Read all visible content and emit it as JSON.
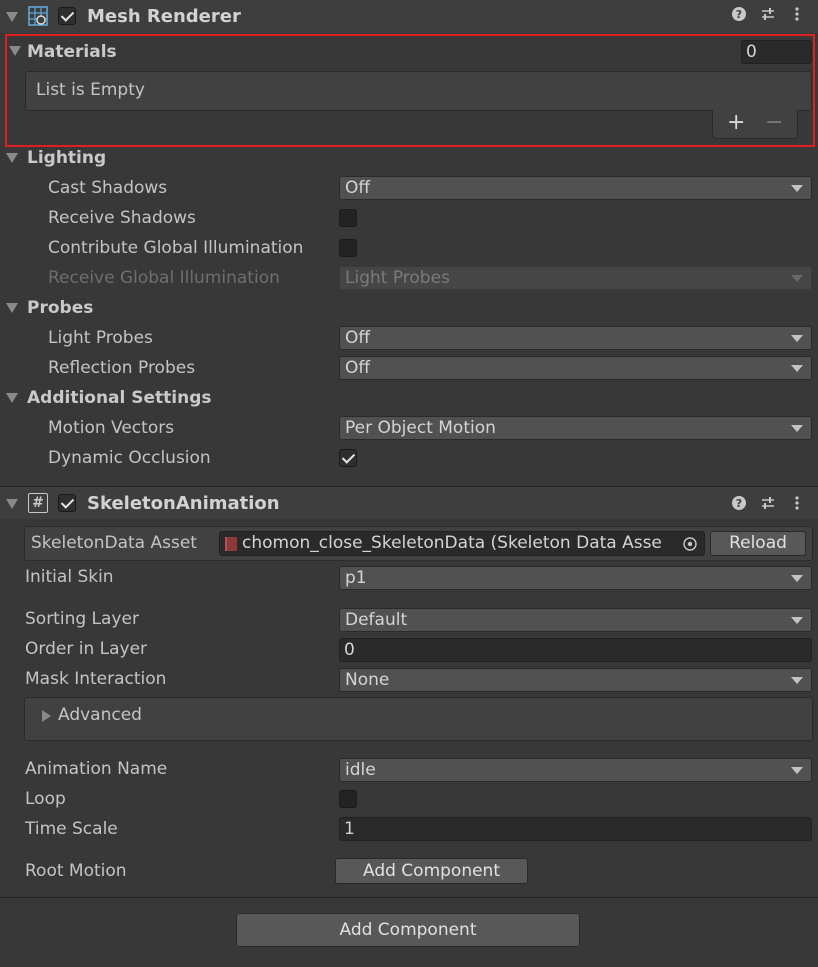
{
  "mesh_renderer": {
    "title": "Mesh Renderer",
    "materials": {
      "label": "Materials",
      "count": "0",
      "empty_text": "List is Empty",
      "add_label": "+",
      "remove_label": "−"
    },
    "lighting": {
      "label": "Lighting",
      "cast_shadows_label": "Cast Shadows",
      "cast_shadows_value": "Off",
      "receive_shadows_label": "Receive Shadows",
      "contribute_gi_label": "Contribute Global Illumination",
      "receive_gi_label": "Receive Global Illumination",
      "receive_gi_value": "Light Probes"
    },
    "probes": {
      "label": "Probes",
      "light_probes_label": "Light Probes",
      "light_probes_value": "Off",
      "reflection_probes_label": "Reflection Probes",
      "reflection_probes_value": "Off"
    },
    "additional": {
      "label": "Additional Settings",
      "motion_vectors_label": "Motion Vectors",
      "motion_vectors_value": "Per Object Motion",
      "dynamic_occlusion_label": "Dynamic Occlusion"
    }
  },
  "skeleton_animation": {
    "title": "SkeletonAnimation",
    "script_icon": "#",
    "skeleton_data_label": "SkeletonData Asset",
    "skeleton_data_value": "chomon_close_SkeletonData (Skeleton Data Asse",
    "reload_label": "Reload",
    "initial_skin_label": "Initial Skin",
    "initial_skin_value": "p1",
    "sorting_layer_label": "Sorting Layer",
    "sorting_layer_value": "Default",
    "order_in_layer_label": "Order in Layer",
    "order_in_layer_value": "0",
    "mask_interaction_label": "Mask Interaction",
    "mask_interaction_value": "None",
    "advanced_label": "Advanced",
    "animation_name_label": "Animation Name",
    "animation_name_value": "idle",
    "loop_label": "Loop",
    "time_scale_label": "Time Scale",
    "time_scale_value": "1",
    "root_motion_label": "Root Motion",
    "root_motion_button": "Add Component"
  },
  "footer": {
    "add_component_label": "Add Component"
  },
  "icons": {
    "help": "help-icon",
    "presets": "presets-icon",
    "menu": "kebab-menu-icon"
  },
  "colors": {
    "panel_bg": "#383838",
    "header_bg": "#3e3e3e",
    "highlight_border": "#e01f1f",
    "field_bg": "#515151"
  }
}
